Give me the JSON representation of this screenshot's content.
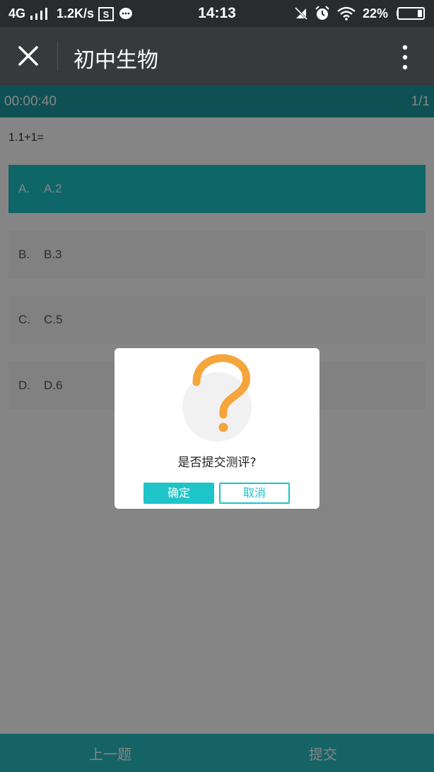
{
  "status_bar": {
    "network": "4G",
    "speed": "1.2K/s",
    "time": "14:13",
    "battery": "22%",
    "icons": [
      "signal-icon",
      "sim-s-icon",
      "chat-icon",
      "mute-icon",
      "alarm-icon",
      "wifi-icon",
      "battery-icon"
    ]
  },
  "app_bar": {
    "title": "初中生物",
    "close_icon": "close-icon",
    "more_icon": "more-vert-icon"
  },
  "quiz": {
    "timer": "00:00:40",
    "progress": "1/1",
    "question": "1.1+1=",
    "options": [
      {
        "letter": "A.",
        "text": "A.2",
        "selected": true
      },
      {
        "letter": "B.",
        "text": "B.3",
        "selected": false
      },
      {
        "letter": "C.",
        "text": "C.5",
        "selected": false
      },
      {
        "letter": "D.",
        "text": "D.6",
        "selected": false
      }
    ]
  },
  "bottom_nav": {
    "prev_label": "上一题",
    "submit_label": "提交"
  },
  "dialog": {
    "icon": "question-mark-icon",
    "message": "是否提交测评?",
    "confirm_label": "确定",
    "cancel_label": "取消"
  },
  "colors": {
    "accent": "#1ec4c8",
    "question_icon": "#f5a53c",
    "app_bar": "#38393d",
    "status_bar": "#2a2b2f"
  }
}
